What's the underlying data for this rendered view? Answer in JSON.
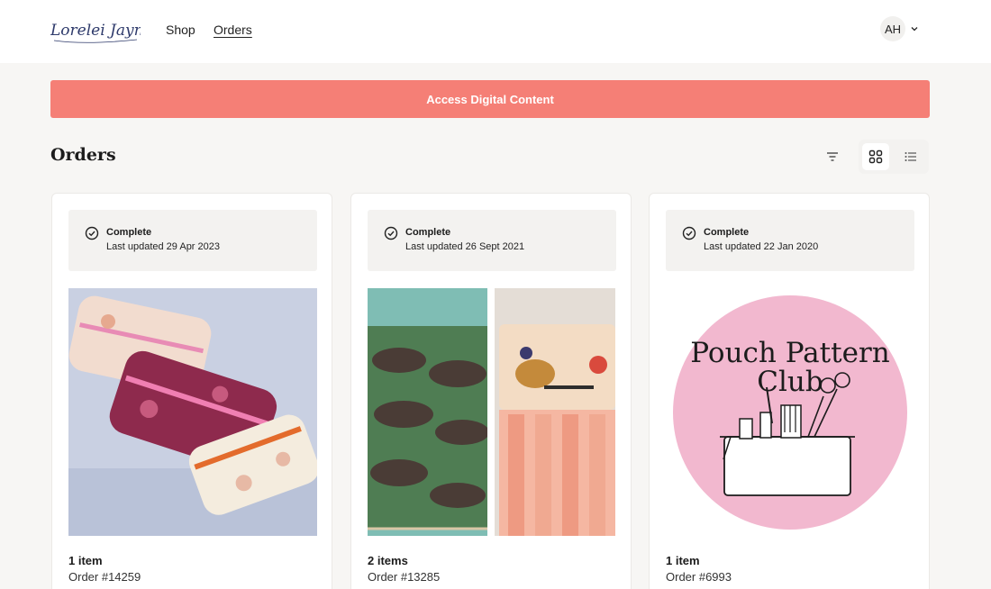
{
  "header": {
    "logo_text": "Lorelei Jayne",
    "nav": {
      "shop": "Shop",
      "orders": "Orders"
    },
    "user_initials": "AH"
  },
  "banner": {
    "label": "Access Digital Content"
  },
  "page": {
    "title": "Orders"
  },
  "orders": [
    {
      "status": "Complete",
      "updated": "Last updated 29 Apr 2023",
      "items": "1 item",
      "order": "Order #14259"
    },
    {
      "status": "Complete",
      "updated": "Last updated 26 Sept 2021",
      "items": "2 items",
      "order": "Order #13285"
    },
    {
      "status": "Complete",
      "updated": "Last updated 22 Jan 2020",
      "items": "1 item",
      "order": "Order #6993"
    }
  ],
  "pouch_logo": {
    "line1": "Pouch Pattern",
    "line2": "Club"
  },
  "colors": {
    "banner": "#f57f76",
    "page_bg": "#f7f6f4",
    "pink_badge": "#f2b8cf"
  }
}
